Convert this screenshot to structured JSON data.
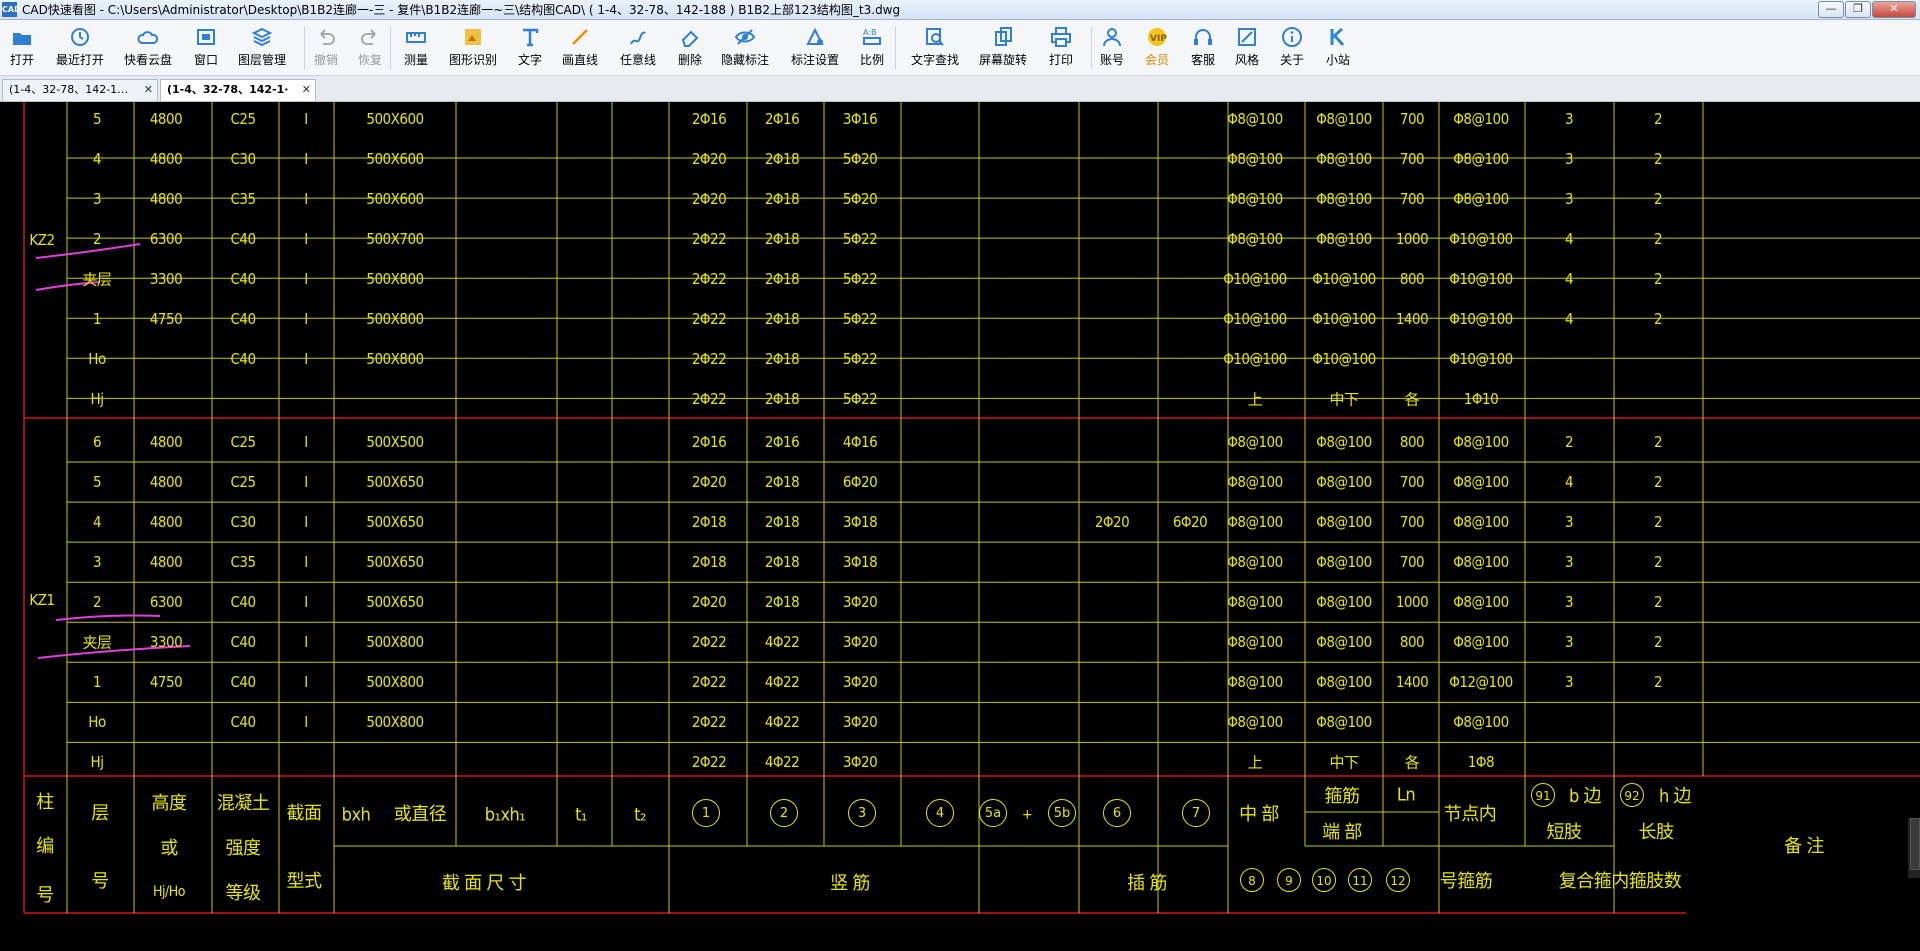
{
  "window": {
    "app_icon": "CAD",
    "title": "CAD快速看图 - C:\\Users\\Administrator\\Desktop\\B1B2连廊一-三 - 复件\\B1B2连廊一~三\\结构图CAD\\ ( 1-4、32-78、142-188 ) B1B2上部123结构图_t3.dwg",
    "min_label": "—",
    "max_label": "❐",
    "close_label": "✕"
  },
  "toolbar": [
    {
      "label": "打开",
      "icon": "folder-icon"
    },
    {
      "label": "最近打开",
      "icon": "recent-icon"
    },
    {
      "label": "快看云盘",
      "icon": "cloud-icon"
    },
    {
      "label": "窗口",
      "icon": "window-icon"
    },
    {
      "label": "图层管理",
      "icon": "layers-icon"
    },
    {
      "label": "撤销",
      "icon": "undo-icon",
      "disabled": true
    },
    {
      "label": "恢复",
      "icon": "redo-icon",
      "disabled": true
    },
    {
      "label": "测量",
      "icon": "measure-icon"
    },
    {
      "label": "图形识别",
      "icon": "shape-recognize-icon"
    },
    {
      "label": "文字",
      "icon": "text-icon"
    },
    {
      "label": "画直线",
      "icon": "line-icon"
    },
    {
      "label": "任意线",
      "icon": "freehand-icon"
    },
    {
      "label": "删除",
      "icon": "eraser-icon"
    },
    {
      "label": "隐藏标注",
      "icon": "eye-icon"
    },
    {
      "label": "标注设置",
      "icon": "annotation-settings-icon"
    },
    {
      "label": "比例",
      "icon": "scale-icon"
    },
    {
      "label": "文字查找",
      "icon": "text-search-icon"
    },
    {
      "label": "屏幕旋转",
      "icon": "rotate-icon"
    },
    {
      "label": "打印",
      "icon": "printer-icon"
    },
    {
      "label": "账号",
      "icon": "user-icon"
    },
    {
      "label": "会员",
      "icon": "vip-icon",
      "vip": true
    },
    {
      "label": "客服",
      "icon": "headset-icon"
    },
    {
      "label": "风格",
      "icon": "style-icon"
    },
    {
      "label": "关于",
      "icon": "info-icon"
    },
    {
      "label": "小站",
      "icon": "k-logo-icon"
    }
  ],
  "tabs": [
    {
      "label": "(1-4、32-78、142-1…",
      "close": "✕",
      "active": false
    },
    {
      "label": "(1-4、32-78、142-1·",
      "close": "✕",
      "active": true
    }
  ],
  "colors": {
    "table_line": "#c8c800",
    "red_line": "#d01818",
    "text": "#e6e600",
    "markup": "#e040e0"
  },
  "table": {
    "group_kz2": {
      "label": "KZ2",
      "rows": [
        [
          "5",
          "4800",
          "C25",
          "I",
          "500X600",
          "2Φ16",
          "2Φ16",
          "3Φ16",
          "",
          "",
          "Φ8@100",
          "Φ8@100",
          "700",
          "Φ8@100",
          "3",
          "2"
        ],
        [
          "4",
          "4800",
          "C30",
          "I",
          "500X600",
          "2Φ20",
          "2Φ18",
          "5Φ20",
          "",
          "",
          "Φ8@100",
          "Φ8@100",
          "700",
          "Φ8@100",
          "3",
          "2"
        ],
        [
          "3",
          "4800",
          "C35",
          "I",
          "500X600",
          "2Φ20",
          "2Φ18",
          "5Φ20",
          "",
          "",
          "Φ8@100",
          "Φ8@100",
          "700",
          "Φ8@100",
          "3",
          "2"
        ],
        [
          "2",
          "6300",
          "C40",
          "I",
          "500X700",
          "2Φ22",
          "2Φ18",
          "5Φ22",
          "",
          "",
          "Φ8@100",
          "Φ8@100",
          "1000",
          "Φ10@100",
          "4",
          "2"
        ],
        [
          "夹层",
          "3300",
          "C40",
          "I",
          "500X800",
          "2Φ22",
          "2Φ18",
          "5Φ22",
          "",
          "",
          "Φ10@100",
          "Φ10@100",
          "800",
          "Φ10@100",
          "4",
          "2"
        ],
        [
          "1",
          "4750",
          "C40",
          "I",
          "500X800",
          "2Φ22",
          "2Φ18",
          "5Φ22",
          "",
          "",
          "Φ10@100",
          "Φ10@100",
          "1400",
          "Φ10@100",
          "4",
          "2"
        ],
        [
          "Ho",
          "",
          "C40",
          "I",
          "500X800",
          "2Φ22",
          "2Φ18",
          "5Φ22",
          "",
          "",
          "Φ10@100",
          "Φ10@100",
          "",
          "Φ10@100",
          "",
          ""
        ],
        [
          "Hj",
          "",
          "",
          "",
          "",
          "2Φ22",
          "2Φ18",
          "5Φ22",
          "",
          "",
          "上",
          "中下",
          "各",
          "1Φ10",
          "",
          ""
        ]
      ]
    },
    "group_kz1": {
      "label": "KZ1",
      "rows": [
        [
          "6",
          "4800",
          "C25",
          "I",
          "500X500",
          "2Φ16",
          "2Φ16",
          "4Φ16",
          "",
          "",
          "Φ8@100",
          "Φ8@100",
          "800",
          "Φ8@100",
          "2",
          "2"
        ],
        [
          "5",
          "4800",
          "C25",
          "I",
          "500X650",
          "2Φ20",
          "2Φ18",
          "6Φ20",
          "",
          "",
          "Φ8@100",
          "Φ8@100",
          "700",
          "Φ8@100",
          "4",
          "2"
        ],
        [
          "4",
          "4800",
          "C30",
          "I",
          "500X650",
          "2Φ18",
          "2Φ18",
          "3Φ18",
          "2Φ20",
          "6Φ20",
          "Φ8@100",
          "Φ8@100",
          "700",
          "Φ8@100",
          "3",
          "2"
        ],
        [
          "3",
          "4800",
          "C35",
          "I",
          "500X650",
          "2Φ18",
          "2Φ18",
          "3Φ18",
          "",
          "",
          "Φ8@100",
          "Φ8@100",
          "700",
          "Φ8@100",
          "3",
          "2"
        ],
        [
          "2",
          "6300",
          "C40",
          "I",
          "500X650",
          "2Φ20",
          "2Φ18",
          "3Φ20",
          "",
          "",
          "Φ8@100",
          "Φ8@100",
          "1000",
          "Φ8@100",
          "3",
          "2"
        ],
        [
          "夹层",
          "3300",
          "C40",
          "I",
          "500X800",
          "2Φ22",
          "4Φ22",
          "3Φ20",
          "",
          "",
          "Φ8@100",
          "Φ8@100",
          "800",
          "Φ8@100",
          "3",
          "2"
        ],
        [
          "1",
          "4750",
          "C40",
          "I",
          "500X800",
          "2Φ22",
          "4Φ22",
          "3Φ20",
          "",
          "",
          "Φ8@100",
          "Φ8@100",
          "1400",
          "Φ12@100",
          "3",
          "2"
        ],
        [
          "Ho",
          "",
          "C40",
          "I",
          "500X800",
          "2Φ22",
          "4Φ22",
          "3Φ20",
          "",
          "",
          "Φ8@100",
          "Φ8@100",
          "",
          "Φ8@100",
          "",
          ""
        ],
        [
          "Hj",
          "",
          "",
          "",
          "",
          "2Φ22",
          "4Φ22",
          "3Φ20",
          "",
          "",
          "上",
          "中下",
          "各",
          "1Φ8",
          "",
          ""
        ]
      ]
    },
    "header": {
      "col1": [
        "柱",
        "编",
        "号"
      ],
      "col2": [
        "层",
        "号"
      ],
      "col3": [
        "高度",
        "或",
        "Hj/Ho"
      ],
      "col4": [
        "混凝土",
        "强度",
        "等级"
      ],
      "col5": [
        "截面",
        "型式"
      ],
      "bxh": "bxh",
      "diam": "或直径",
      "b1h1": "b₁xh₁",
      "t1": "t₁",
      "t2": "t₂",
      "section_size": "截 面 尺 寸",
      "c1": "1",
      "c2": "2",
      "c3": "3",
      "c4": "4",
      "c5a": "5a",
      "plus": "+",
      "c5b": "5b",
      "c6": "6",
      "c7": "7",
      "vertical_bars": "竖        筋",
      "dowel": "插   筋",
      "middle": "中 部",
      "stirrup": "箍筋",
      "ln": "Ln",
      "ends": "端   部",
      "node_inner": "节点内",
      "c91": "91",
      "b_side": "b 边",
      "c92": "92",
      "h_side": "h 边",
      "short_leg": "短肢",
      "long_leg": "长肢",
      "c8": "8",
      "c9": "9",
      "c10": "10",
      "c11": "11",
      "c12": "12",
      "stirrup_no": "号箍筋",
      "composite": "复合箍内箍肢数",
      "remark": "备  注"
    }
  }
}
